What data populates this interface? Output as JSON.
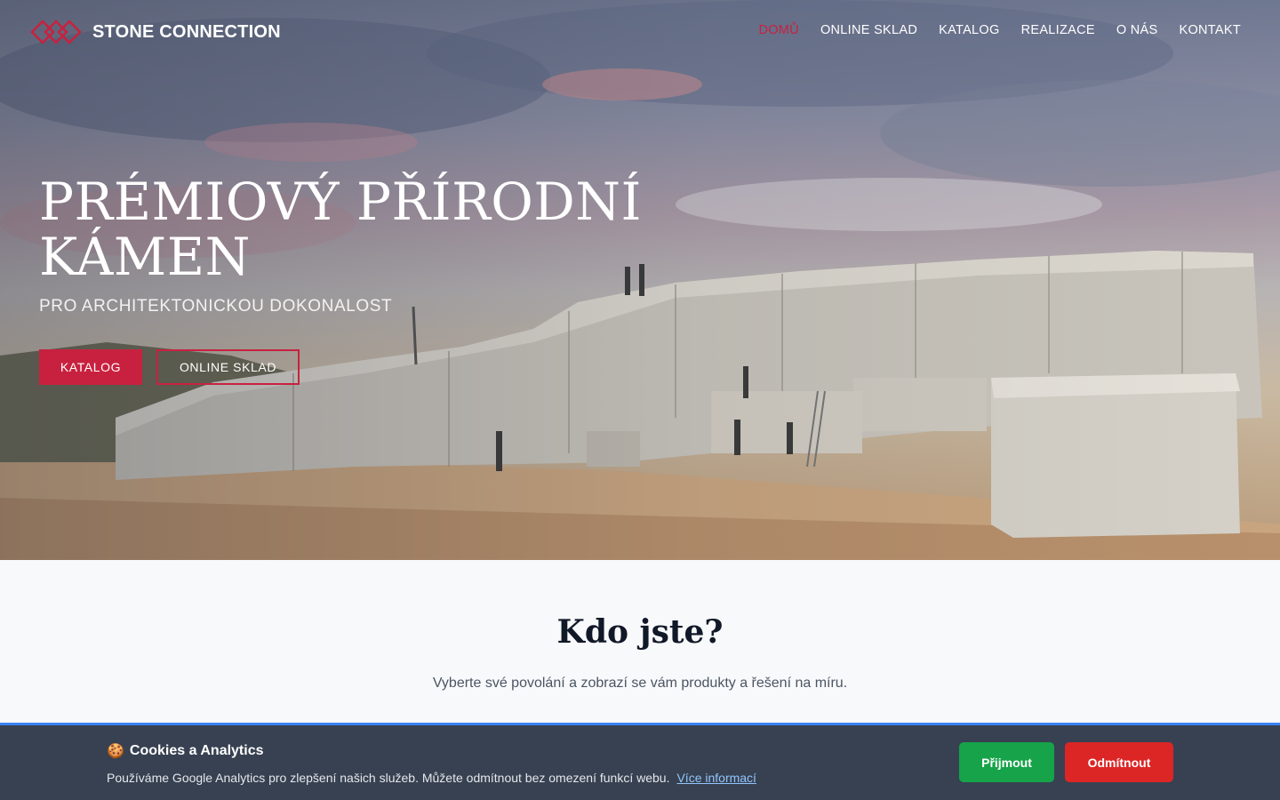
{
  "brand": {
    "name": "STONE CONNECTION",
    "accent": "#c8213f"
  },
  "nav": {
    "items": [
      {
        "label": "DOMŮ",
        "active": true
      },
      {
        "label": "ONLINE SKLAD",
        "active": false
      },
      {
        "label": "KATALOG",
        "active": false
      },
      {
        "label": "REALIZACE",
        "active": false
      },
      {
        "label": "O NÁS",
        "active": false
      },
      {
        "label": "KONTAKT",
        "active": false
      }
    ]
  },
  "hero": {
    "title": "PRÉMIOVÝ PŘÍRODNÍ KÁMEN",
    "subtitle": "PRO ARCHITEKTONICKOU DOKONALOST",
    "primary_button": "KATALOG",
    "secondary_button": "ONLINE SKLAD",
    "image": "stone quarry with workers and marble blocks"
  },
  "section": {
    "title": "Kdo jste?",
    "description": "Vyberte své povolání a zobrazí se vám produkty a řešení na míru."
  },
  "cookie": {
    "title": "Cookies a Analytics",
    "icon": "cookie-icon",
    "text": "Používáme Google Analytics pro zlepšení našich služeb. Můžete odmítnout bez omezení funkcí webu.",
    "link": "Více informací",
    "accept_label": "Přijmout",
    "decline_label": "Odmítnout",
    "accept_color": "#16a34a",
    "decline_color": "#dc2626"
  }
}
